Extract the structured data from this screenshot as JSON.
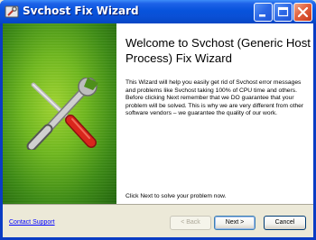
{
  "window": {
    "title": "Svchost Fix Wizard"
  },
  "titlebar_buttons": {
    "minimize": "minimize-icon",
    "maximize": "maximize-icon",
    "close": "close-icon"
  },
  "banner": {
    "icon": "wrench-screwdriver-icon"
  },
  "content": {
    "heading": "Welcome to Svchost (Generic Host Process) Fix Wizard",
    "body": "This Wizard will help you easily get rid of Svchost error messages and problems like Svchost taking 100% of CPU time and others. Before clicking Next remember that we DO guarantee that your problem will be solved. This is why we are very different from other software vendors – we guarantee the quality of our work.",
    "instruction": "Click Next to solve your problem now."
  },
  "footer": {
    "support_link": "Contact Support",
    "back_label": "< Back",
    "next_label": "Next >",
    "cancel_label": "Cancel"
  },
  "colors": {
    "titlebar": "#0A50D6",
    "banner_green": "#6FB81E",
    "dialog_bg": "#ECE9D8",
    "link": "#0000FF"
  }
}
